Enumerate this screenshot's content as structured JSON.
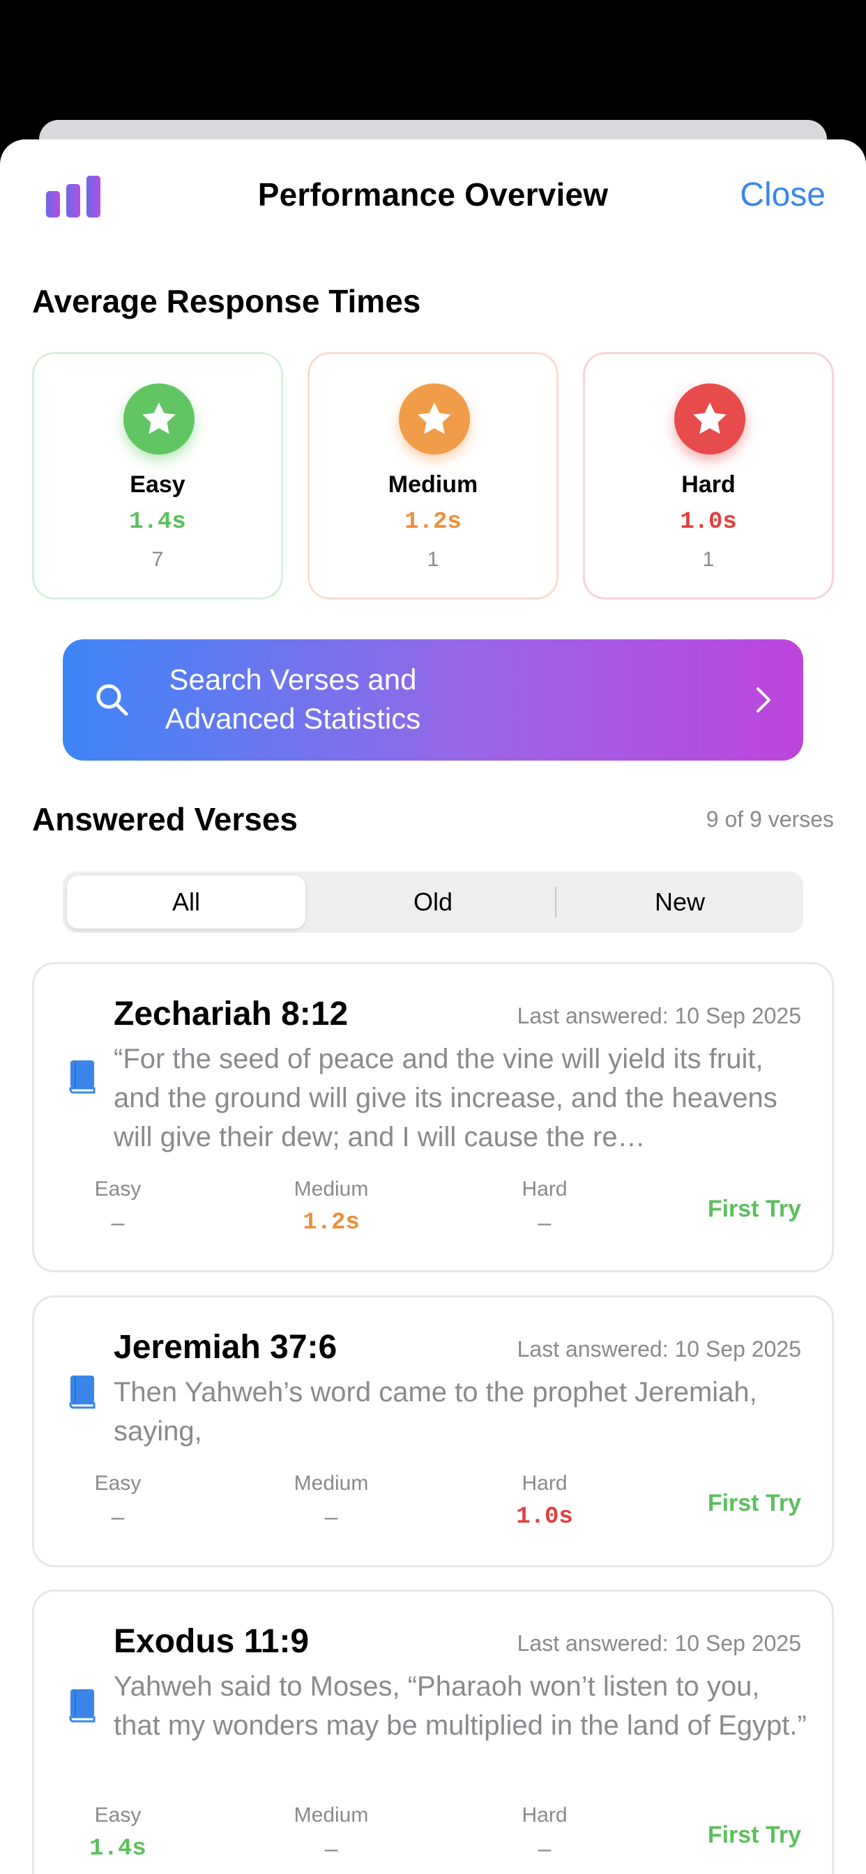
{
  "header": {
    "title": "Performance Overview",
    "close_label": "Close",
    "icon": "bar-chart-icon"
  },
  "response_times": {
    "title": "Average Response Times",
    "cards": [
      {
        "label": "Easy",
        "time": "1.4s",
        "count": "7",
        "color": "#62c564"
      },
      {
        "label": "Medium",
        "time": "1.2s",
        "count": "1",
        "color": "#f19c48"
      },
      {
        "label": "Hard",
        "time": "1.0s",
        "count": "1",
        "color": "#e84b4b"
      }
    ]
  },
  "search_banner": {
    "line1": "Search Verses and",
    "line2": "Advanced Statistics",
    "gradient": [
      "#3d86f7",
      "#bd45dc"
    ]
  },
  "answered": {
    "title": "Answered Verses",
    "count_text": "9 of 9 verses",
    "segments": [
      "All",
      "Old",
      "New"
    ],
    "selected_segment": "All"
  },
  "verses": [
    {
      "reference": "Zechariah 8:12",
      "last_answered": "Last answered: 10 Sep 2025",
      "text": "“For the seed of peace and the vine will yield its fruit, and the ground will give its increase, and the heavens will give their dew; and I will cause the re…",
      "easy_label": "Easy",
      "easy": "–",
      "medium_label": "Medium",
      "medium": "1.2s",
      "hard_label": "Hard",
      "hard": "–",
      "result": "First Try"
    },
    {
      "reference": "Jeremiah 37:6",
      "last_answered": "Last answered: 10 Sep 2025",
      "text": "Then Yahweh’s word came to the prophet Jeremiah, saying,",
      "easy_label": "Easy",
      "easy": "–",
      "medium_label": "Medium",
      "medium": "–",
      "hard_label": "Hard",
      "hard": "1.0s",
      "result": "First Try"
    },
    {
      "reference": "Exodus 11:9",
      "last_answered": "Last answered: 10 Sep 2025",
      "text": "Yahweh said to Moses, “Pharaoh won’t listen to you, that my wonders may be multiplied in the land of Egypt.”",
      "easy_label": "Easy",
      "easy": "1.4s",
      "medium_label": "Medium",
      "medium": "–",
      "hard_label": "Hard",
      "hard": "–",
      "result": "First Try"
    }
  ]
}
